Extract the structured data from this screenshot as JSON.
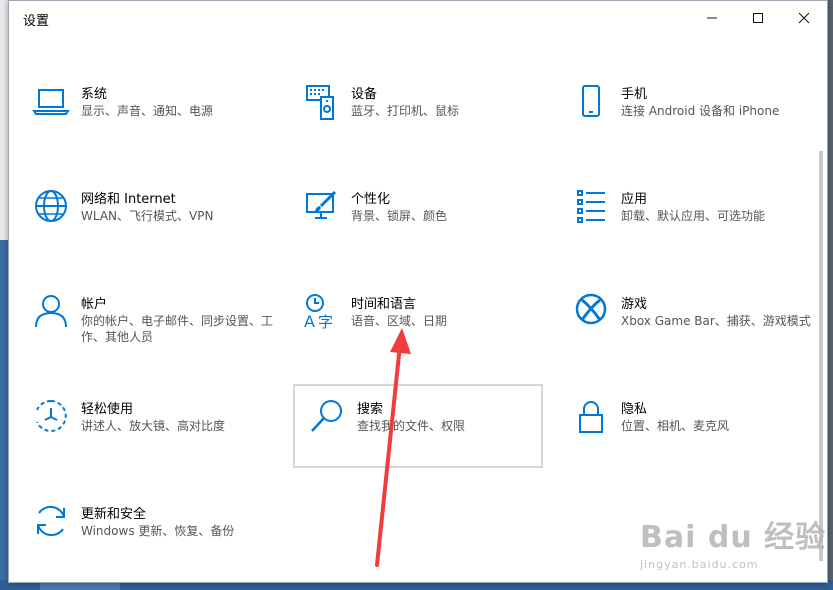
{
  "window": {
    "title": "设置"
  },
  "tiles": [
    {
      "name": "系统",
      "desc": "显示、声音、通知、电源"
    },
    {
      "name": "设备",
      "desc": "蓝牙、打印机、鼠标"
    },
    {
      "name": "手机",
      "desc": "连接 Android 设备和 iPhone"
    },
    {
      "name": "网络和 Internet",
      "desc": "WLAN、飞行模式、VPN"
    },
    {
      "name": "个性化",
      "desc": "背景、锁屏、颜色"
    },
    {
      "name": "应用",
      "desc": "卸载、默认应用、可选功能"
    },
    {
      "name": "帐户",
      "desc": "你的帐户、电子邮件、同步设置、工作、其他人员"
    },
    {
      "name": "时间和语言",
      "desc": "语音、区域、日期"
    },
    {
      "name": "游戏",
      "desc": "Xbox Game Bar、捕获、游戏模式"
    },
    {
      "name": "轻松使用",
      "desc": "讲述人、放大镜、高对比度"
    },
    {
      "name": "搜索",
      "desc": "查找我的文件、权限"
    },
    {
      "name": "隐私",
      "desc": "位置、相机、麦克风"
    },
    {
      "name": "更新和安全",
      "desc": "Windows 更新、恢复、备份"
    }
  ],
  "watermark": {
    "brand": "Bai du 经验",
    "url": "jingyan.baidu.com"
  },
  "colors": {
    "accent": "#0078d7",
    "arrow": "#f03c3c"
  }
}
